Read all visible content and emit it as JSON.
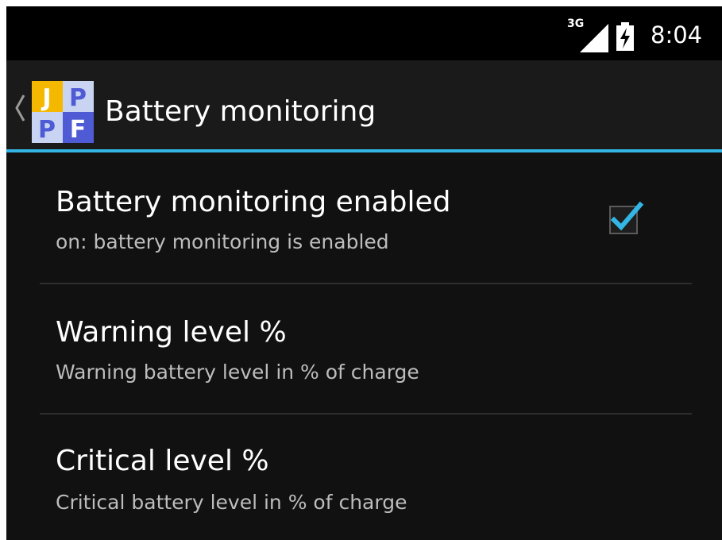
{
  "status_bar": {
    "network": "3G",
    "time": "8:04"
  },
  "action_bar": {
    "title": "Battery monitoring",
    "logo_letters": [
      "J",
      "P",
      "P",
      "F"
    ]
  },
  "preferences": [
    {
      "title": "Battery monitoring enabled",
      "summary": "on: battery monitoring is enabled",
      "checked": true
    },
    {
      "title": "Warning level %",
      "summary": "Warning battery level in % of charge"
    },
    {
      "title": "Critical level %",
      "summary": "Critical battery level in % of charge"
    }
  ],
  "colors": {
    "accent": "#33b5e5",
    "background": "#111111",
    "logo_yellow": "#f5b800",
    "logo_blue": "#4f5bd5",
    "logo_light": "#c9d4f2"
  }
}
